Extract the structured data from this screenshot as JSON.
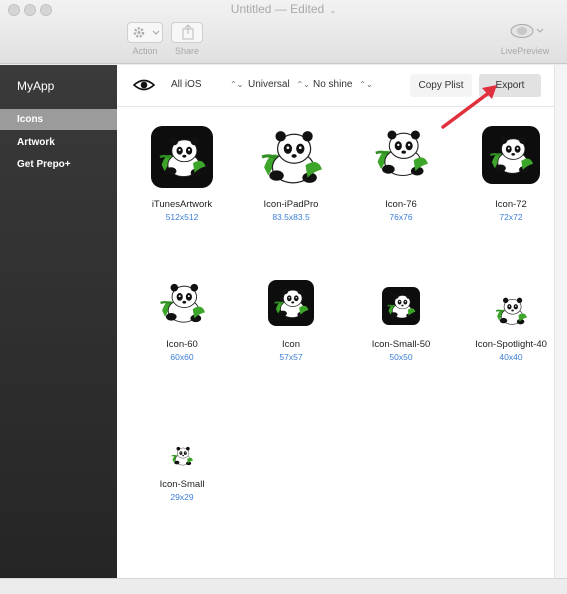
{
  "window": {
    "title": "Untitled",
    "status": "— Edited",
    "chevron": "⌄"
  },
  "toolbar_top": {
    "action_label": "Action",
    "share_label": "Share",
    "livepreview_label": "LivePreview"
  },
  "sidebar": {
    "app_name": "MyApp",
    "items": [
      {
        "label": "Icons",
        "active": true
      },
      {
        "label": "Artwork",
        "active": false
      },
      {
        "label": "Get Prepo+",
        "active": false
      }
    ]
  },
  "filters": {
    "platform": "All iOS",
    "device": "Universal",
    "shine": "No shine",
    "arrows": "⌃⌄"
  },
  "buttons": {
    "copy_plist": "Copy Plist",
    "export": "Export"
  },
  "icons": [
    {
      "name": "iTunesArtwork",
      "size": "512x512"
    },
    {
      "name": "Icon-iPadPro",
      "size": "83.5x83.5"
    },
    {
      "name": "Icon-76",
      "size": "76x76"
    },
    {
      "name": "Icon-72",
      "size": "72x72"
    },
    {
      "name": "Icon-60",
      "size": "60x60"
    },
    {
      "name": "Icon",
      "size": "57x57"
    },
    {
      "name": "Icon-Small-50",
      "size": "50x50"
    },
    {
      "name": "Icon-Spotlight-40",
      "size": "40x40"
    },
    {
      "name": "Icon-Small",
      "size": "29x29"
    }
  ],
  "colors": {
    "accent_link": "#3c7ed7",
    "annotation_arrow": "#e0303e",
    "sidebar_active": "#9b9b9b"
  }
}
